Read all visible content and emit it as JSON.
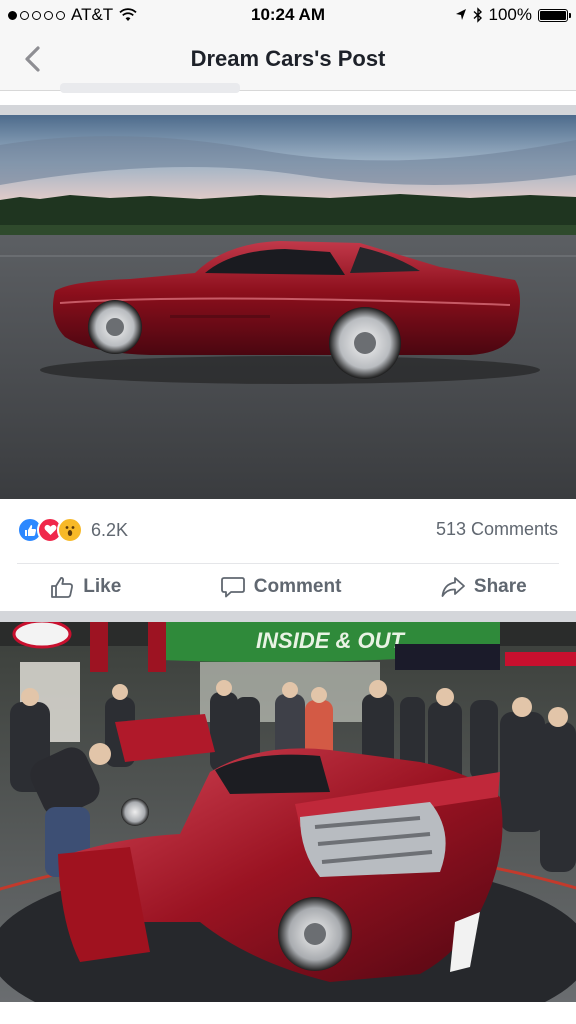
{
  "status_bar": {
    "carrier": "AT&T",
    "time": "10:24 AM",
    "battery": "100%"
  },
  "nav": {
    "title": "Dream Cars's Post"
  },
  "post": {
    "reactions": [
      "like-icon",
      "love-icon",
      "wow-icon"
    ],
    "reaction_count": "6.2K",
    "comments_count": "513 Comments",
    "actions": {
      "like": "Like",
      "comment": "Comment",
      "share": "Share"
    }
  },
  "colors": {
    "accent": "#1877f2",
    "header_bg": "#f7f7f7",
    "feed_bg": "#d4d6da",
    "car_red": "#8c0f1c"
  },
  "expo_banner": {
    "headline": "INSIDE & OUT"
  }
}
